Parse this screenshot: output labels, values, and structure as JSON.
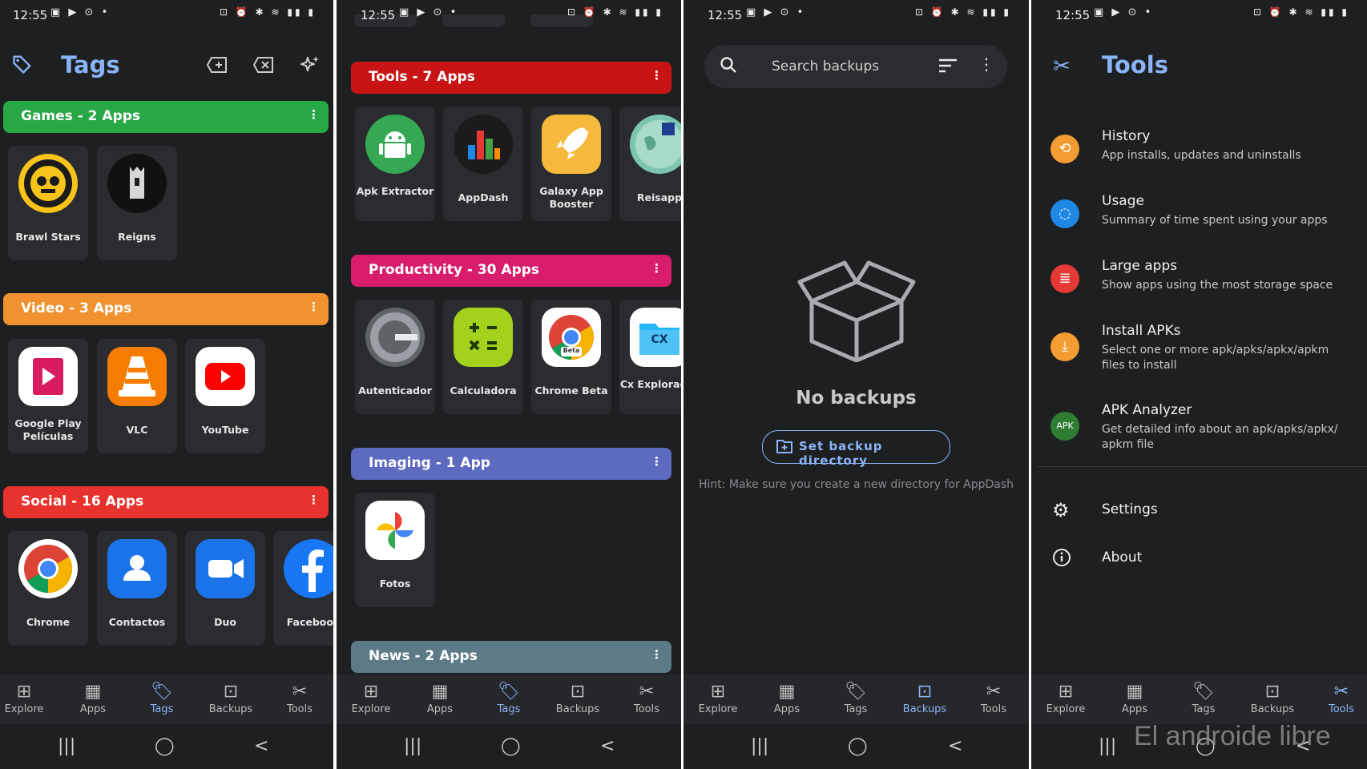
{
  "status": {
    "time": "12:55",
    "left_icons": "▣ ▶ ⊙ •",
    "right_icons": "⊡ ⏰ ✱ ≋ ▮▮ ▮"
  },
  "nav": {
    "explore": "Explore",
    "apps": "Apps",
    "tags": "Tags",
    "backups": "Backups",
    "tools": "Tools"
  },
  "colors": {
    "accent": "#8ab4f8",
    "games": "#28a745",
    "video": "#f0922f",
    "social": "#e8322d",
    "tools": "#c81414",
    "productivity": "#d81d6d",
    "imaging": "#5c6bc0",
    "news": "#5d7a87"
  },
  "screen1": {
    "title": "Tags",
    "games": {
      "label": "Games - 2 Apps",
      "apps": [
        "Brawl Stars",
        "Reigns"
      ]
    },
    "video": {
      "label": "Video - 3 Apps",
      "apps": [
        "Google Play Películas",
        "VLC",
        "YouTube"
      ]
    },
    "social": {
      "label": "Social - 16 Apps",
      "apps": [
        "Chrome",
        "Contactos",
        "Duo",
        "Facebook"
      ]
    }
  },
  "screen2": {
    "tools": {
      "label": "Tools - 7 Apps",
      "apps": [
        "Apk Extractor",
        "AppDash",
        "Galaxy App Booster",
        "Reisapp"
      ]
    },
    "productivity": {
      "label": "Productivity - 30 Apps",
      "apps": [
        "Autenticador",
        "Calculadora",
        "Chrome Beta",
        "Cx Explorador"
      ]
    },
    "imaging": {
      "label": "Imaging - 1 App",
      "apps": [
        "Fotos"
      ]
    },
    "news": {
      "label": "News - 2 Apps"
    },
    "beta_badge": "Beta",
    "cx_badge": "CX"
  },
  "screen3": {
    "search_placeholder": "Search backups",
    "empty_title": "No backups",
    "set_dir_button": "Set backup directory",
    "hint": "Hint: Make sure you create a new directory for AppDash"
  },
  "screen4": {
    "title": "Tools",
    "items": [
      {
        "title": "History",
        "desc": "App installs, updates and uninstalls"
      },
      {
        "title": "Usage",
        "desc": "Summary of time spent using your apps"
      },
      {
        "title": "Large apps",
        "desc": "Show apps using the most storage space"
      },
      {
        "title": "Install APKs",
        "desc": "Select one or more apk/apks/apkx/apkm files to install"
      },
      {
        "title": "APK Analyzer",
        "desc": "Get detailed info about an apk/apks/apkx/ apkm file",
        "badge": "APK"
      }
    ],
    "settings": "Settings",
    "about": "About",
    "watermark": "El androide libre"
  }
}
